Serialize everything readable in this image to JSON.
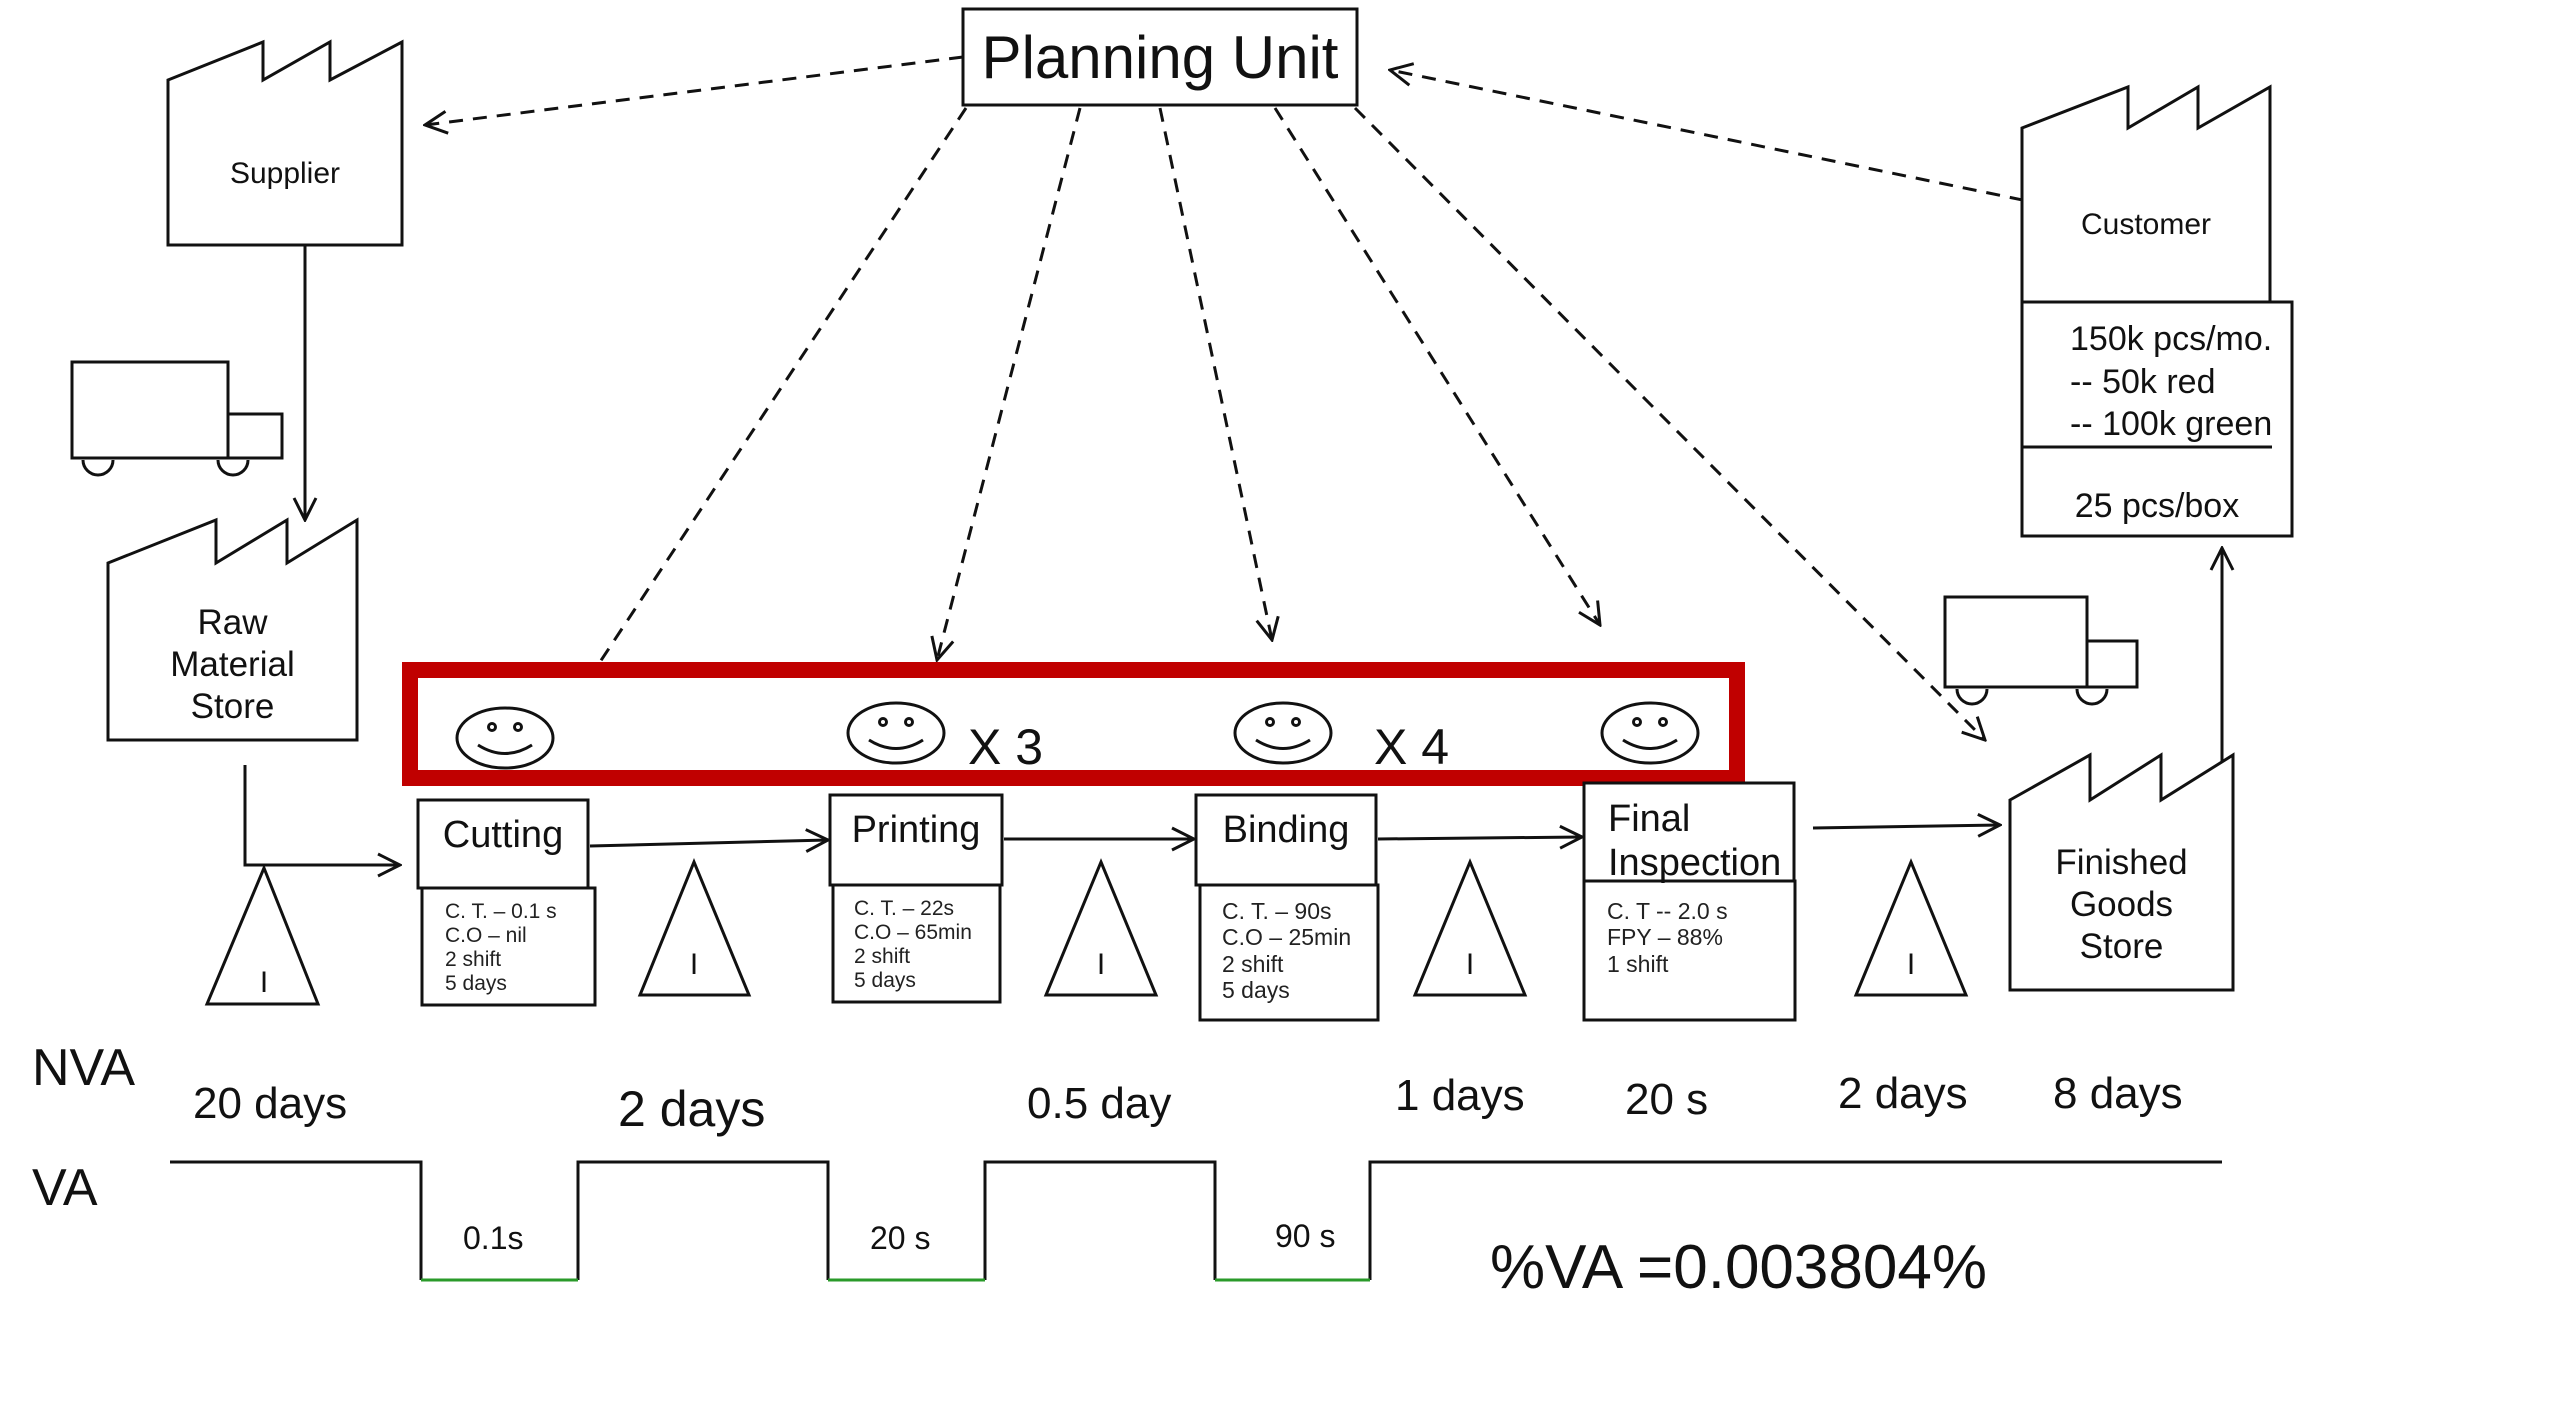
{
  "planning_unit": {
    "label": "Planning Unit"
  },
  "supplier": {
    "label": "Supplier"
  },
  "customer": {
    "label": "Customer",
    "demand_lines": [
      "150k pcs/mo.",
      "--  50k red",
      "-- 100k green"
    ],
    "packing": "25 pcs/box"
  },
  "raw_material_store": {
    "lines": [
      "Raw",
      "Material",
      "Store"
    ]
  },
  "finished_goods_store": {
    "lines": [
      "Finished",
      "Goods",
      "Store"
    ]
  },
  "operators": [
    {
      "multiplier": ""
    },
    {
      "multiplier": "X 3"
    },
    {
      "multiplier": "X 4"
    },
    {
      "multiplier": ""
    }
  ],
  "processes": [
    {
      "name": "Cutting",
      "data": [
        "C. T. – 0.1 s",
        "C.O – nil",
        "2 shift",
        "5 days"
      ]
    },
    {
      "name": "Printing",
      "data": [
        "C. T. – 22s",
        "C.O – 65min",
        "2 shift",
        "5 days"
      ]
    },
    {
      "name": "Binding",
      "data": [
        "C. T. – 90s",
        "C.O – 25min",
        "2 shift",
        "5 days"
      ]
    },
    {
      "name_lines": [
        "Final",
        "Inspection"
      ],
      "data": [
        "C. T -- 2.0 s",
        "FPY – 88%",
        "1 shift"
      ]
    }
  ],
  "inventory_symbol": "I",
  "timeline": {
    "nva_label": "NVA",
    "va_label": "VA",
    "nva_values": [
      "20 days",
      "2 days",
      "0.5 day",
      "1 days",
      "20 s",
      "2 days",
      "8 days"
    ],
    "va_values": [
      "0.1s",
      "20 s",
      "90 s"
    ],
    "percent_va": "%VA =0.003804%"
  },
  "colors": {
    "operator_box": "#c00000",
    "va_segment": "#2a9a2a",
    "line": "#111111"
  }
}
